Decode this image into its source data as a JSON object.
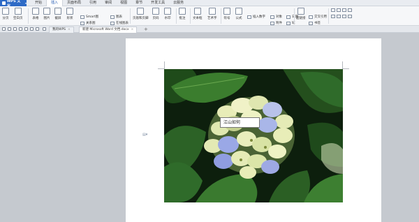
{
  "app": {
    "name": "WPS 文字"
  },
  "menu": {
    "tabs": [
      {
        "label": "开始"
      },
      {
        "label": "插入",
        "active": true
      },
      {
        "label": "页面布局"
      },
      {
        "label": "引用"
      },
      {
        "label": "审阅"
      },
      {
        "label": "视图"
      },
      {
        "label": "章节"
      },
      {
        "label": "开发工具"
      },
      {
        "label": "云服务"
      }
    ]
  },
  "ribbon": {
    "buttons": [
      {
        "label": "分页"
      },
      {
        "label": "空白页"
      },
      {
        "label": "表格"
      },
      {
        "label": "图片"
      },
      {
        "label": "截屏"
      },
      {
        "label": "形状"
      },
      {
        "label": "Smart图"
      },
      {
        "label": "图表"
      },
      {
        "label": "关系图"
      },
      {
        "label": "在线图表"
      },
      {
        "label": "页眉和页脚"
      },
      {
        "label": "页码"
      },
      {
        "label": "水印"
      },
      {
        "label": "批注"
      },
      {
        "label": "文本框"
      },
      {
        "label": "艺术字"
      },
      {
        "label": "符号"
      },
      {
        "label": "公式"
      },
      {
        "label": "插入数字"
      },
      {
        "label": "对象"
      },
      {
        "label": "日期"
      },
      {
        "label": "附件"
      },
      {
        "label": "域"
      },
      {
        "label": "超链接"
      },
      {
        "label": "交叉引用"
      },
      {
        "label": "书签"
      }
    ]
  },
  "tabstrip": {
    "tabs": [
      {
        "label": "我的WPS"
      },
      {
        "label": "新建 Microsoft Word 文档.docx",
        "active": true
      }
    ],
    "add_label": "+"
  },
  "document": {
    "caption": "江山如何"
  },
  "colors": {
    "accent": "#2e6bc6",
    "leaf": "#2f6b2a",
    "petal_cream": "#e8edb8",
    "petal_blue": "#9aa8e6",
    "background": "#c5c9cf"
  }
}
